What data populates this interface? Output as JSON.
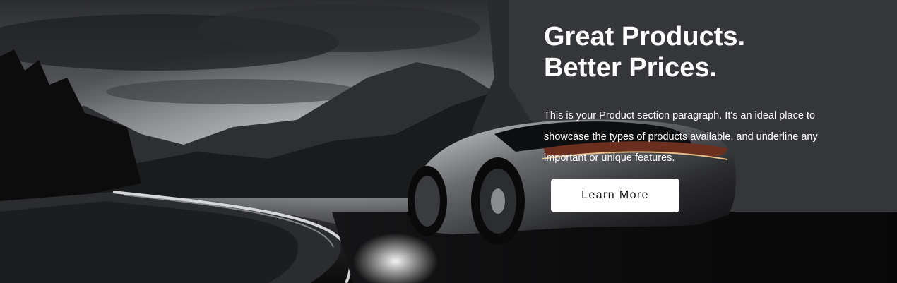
{
  "hero": {
    "title_line_1": "Great Products.",
    "title_line_2": "Better Prices.",
    "paragraph": "This is your Product section paragraph. It's an ideal place to showcase the types of products available, and underline any important or unique features.",
    "cta_label": "Learn More"
  },
  "colors": {
    "text": "#ffffff",
    "button_bg": "#ffffff",
    "button_text": "#111111"
  }
}
